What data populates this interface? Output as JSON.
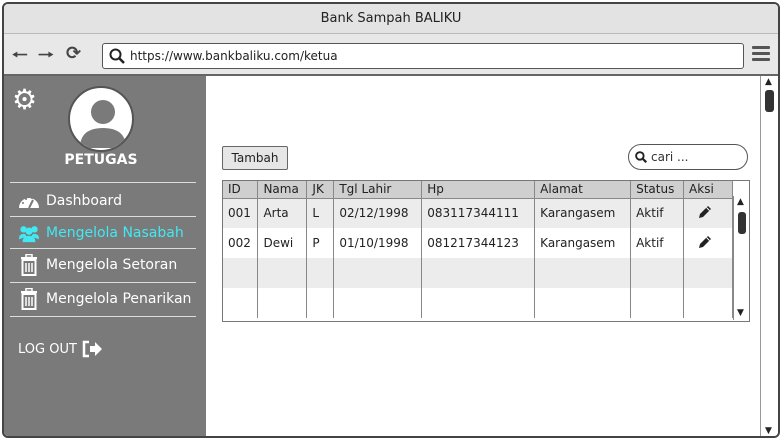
{
  "window": {
    "title": "Bank Sampah BALIKU"
  },
  "browser": {
    "url": "https://www.bankbaliku.com/ketua"
  },
  "sidebar": {
    "role": "PETUGAS",
    "items": [
      {
        "label": "Dashboard",
        "icon": "dashboard-gauge-icon",
        "active": false
      },
      {
        "label": "Mengelola Nasabah",
        "icon": "users-icon",
        "active": true
      },
      {
        "label": "Mengelola Setoran",
        "icon": "trash-icon",
        "active": false
      },
      {
        "label": "Mengelola Penarikan",
        "icon": "trash-icon",
        "active": false
      }
    ],
    "logout_label": "LOG OUT",
    "accent_color": "#42e8f2",
    "bg_color": "#7a7a7a"
  },
  "main": {
    "add_button": "Tambah",
    "search_placeholder": "cari ...",
    "table": {
      "columns": [
        "ID",
        "Nama",
        "JK",
        "Tgl Lahir",
        "Hp",
        "Alamat",
        "Status",
        "Aksi"
      ],
      "rows": [
        {
          "id": "001",
          "nama": "Arta",
          "jk": "L",
          "tgl_lahir": "02/12/1998",
          "hp": "083117344111",
          "alamat": "Karangasem",
          "status": "Aktif"
        },
        {
          "id": "002",
          "nama": "Dewi",
          "jk": "P",
          "tgl_lahir": "01/10/1998",
          "hp": "081217344123",
          "alamat": "Karangasem",
          "status": "Aktif"
        }
      ]
    }
  }
}
